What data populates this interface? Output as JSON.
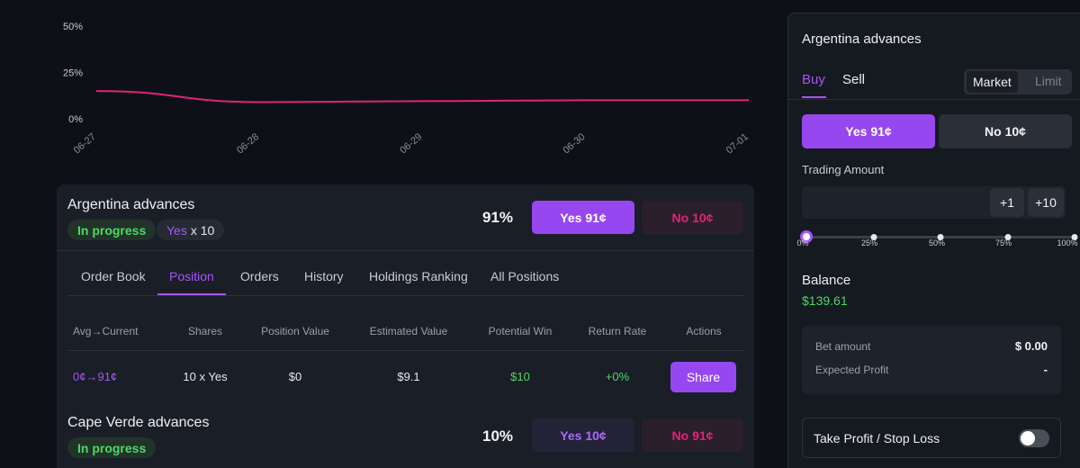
{
  "chart_data": {
    "type": "line",
    "x": [
      "06-27",
      "06-28",
      "06-29",
      "06-30",
      "07-01"
    ],
    "series": [
      {
        "values": [
          15,
          9,
          9.5,
          10,
          10
        ],
        "color": "#e0237a"
      }
    ],
    "y_ticks": [
      "50%",
      "25%",
      "0%"
    ],
    "ylim": [
      0,
      50
    ],
    "grid": false
  },
  "position_card": {
    "title": "Argentina advances",
    "status": "In progress",
    "holding_side": "Yes",
    "holding_qty": "x 10",
    "percent": "91%",
    "yes_label": "Yes 91¢",
    "no_label": "No 10¢"
  },
  "tabs": [
    "Order Book",
    "Position",
    "Orders",
    "History",
    "Holdings Ranking",
    "All Positions"
  ],
  "active_tab": "Position",
  "table": {
    "headers": [
      "Avg→Current",
      "Shares",
      "Position Value",
      "Estimated Value",
      "Potential Win",
      "Return Rate",
      "Actions"
    ],
    "row": {
      "avg_current": "0¢→91¢",
      "shares": "10 x Yes",
      "position_value": "$0",
      "estimated_value": "$9.1",
      "potential_win": "$10",
      "return_rate": "+0%",
      "action": "Share"
    }
  },
  "market2": {
    "title": "Cape Verde advances",
    "status": "In progress",
    "percent": "10%",
    "yes_label": "Yes 10¢",
    "no_label": "No 91¢"
  },
  "trade_panel": {
    "title": "Argentina advances",
    "buy_label": "Buy",
    "sell_label": "Sell",
    "market_label": "Market",
    "limit_label": "Limit",
    "yes_label": "Yes 91¢",
    "no_label": "No 10¢",
    "amount_label": "Trading Amount",
    "amount_value": "",
    "plus1": "+1",
    "plus10": "+10",
    "slider_marks": [
      "0%",
      "25%",
      "50%",
      "75%",
      "100%"
    ],
    "slider_value": 0,
    "balance_label": "Balance",
    "balance_value": "$139.61",
    "bet_amount_label": "Bet amount",
    "bet_amount_value": "$ 0.00",
    "expected_profit_label": "Expected Profit",
    "expected_profit_value": "-",
    "tpsl_label": "Take Profit / Stop Loss",
    "tpsl_enabled": false
  },
  "colors": {
    "accent": "#a855f7",
    "positive": "#4cd964",
    "negative": "#e0237a",
    "line": "#e0237a"
  }
}
